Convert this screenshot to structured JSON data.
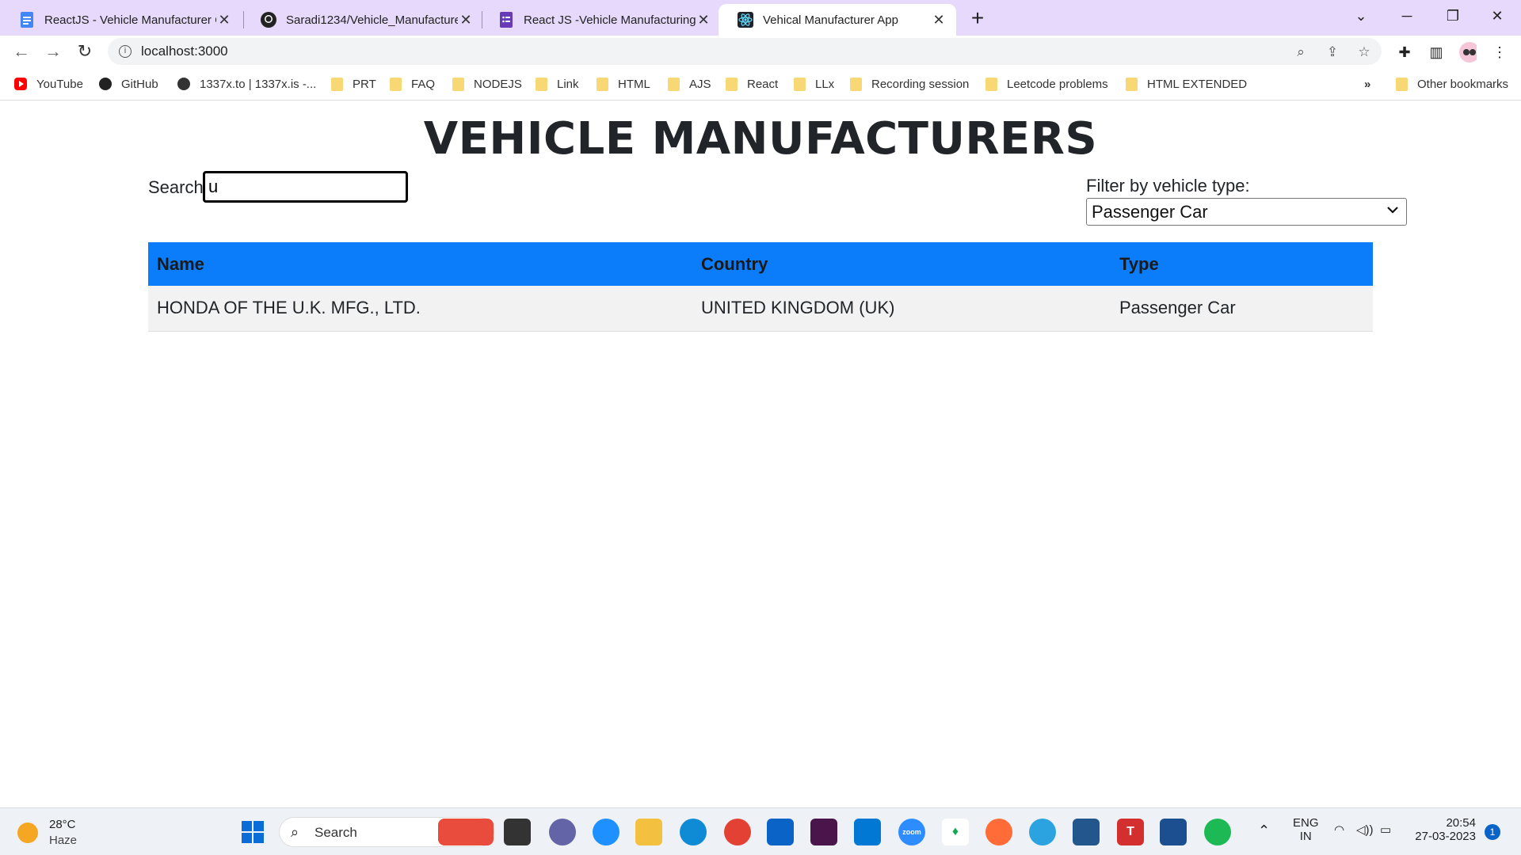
{
  "browser": {
    "tabs": [
      {
        "title": "ReactJS - Vehicle Manufacturer C",
        "icon": "docs-icon",
        "color": "#4285f4"
      },
      {
        "title": "Saradi1234/Vehicle_Manufacture",
        "icon": "github-icon",
        "color": "#222222"
      },
      {
        "title": "React JS -Vehicle Manufacturing",
        "icon": "forms-icon",
        "color": "#673ab7"
      },
      {
        "title": "Vehical Manufacturer App",
        "icon": "react-icon",
        "color": "#61dafb"
      }
    ],
    "url": "localhost:3000",
    "bookmarks": [
      "YouTube",
      "GitHub",
      "1337x.to | 1337x.is -...",
      "PRT",
      "FAQ",
      "NODEJS",
      "Link",
      "HTML",
      "AJS",
      "React",
      "LLx",
      "Recording session",
      "Leetcode problems",
      "HTML EXTENDED"
    ],
    "other_bookmarks": "Other bookmarks",
    "overflow": "»"
  },
  "app": {
    "title": "VEHICLE MANUFACTURERS",
    "search_label": "Search:",
    "search_value": "u",
    "filter_label": "Filter by vehicle type:",
    "filter_selected": "Passenger Car",
    "table": {
      "headers": [
        "Name",
        "Country",
        "Type"
      ],
      "rows": [
        [
          "HONDA OF THE U.K. MFG., LTD.",
          "UNITED KINGDOM (UK)",
          "Passenger Car"
        ]
      ],
      "header_color": "#0b7dfb"
    }
  },
  "taskbar": {
    "temperature": "28°C",
    "weather": "Haze",
    "search_label": "Search",
    "language": "ENG",
    "region": "IN",
    "time": "20:54",
    "date": "27-03-2023",
    "notifications": "1"
  }
}
